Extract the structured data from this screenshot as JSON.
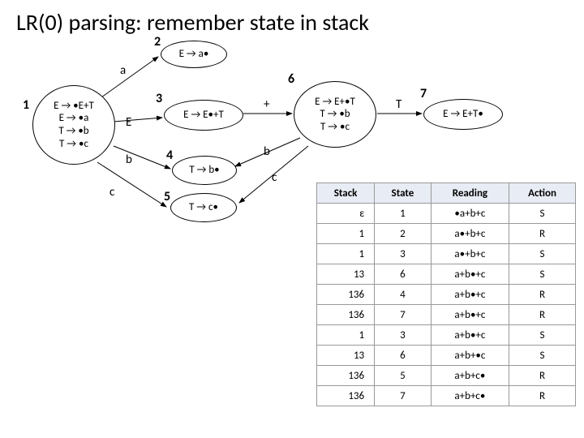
{
  "title": "LR(0) parsing: remember state in stack",
  "states": {
    "s1": {
      "num": "1",
      "lines": [
        "E → •E+T",
        "E → •a",
        "T → •b",
        "T → •c"
      ]
    },
    "s2": {
      "num": "2",
      "lines": [
        "E → a•"
      ]
    },
    "s3": {
      "num": "3",
      "lines": [
        "E → E•+T"
      ]
    },
    "s4": {
      "num": "4",
      "lines": [
        "T → b•"
      ]
    },
    "s5": {
      "num": "5",
      "lines": [
        "T → c•"
      ]
    },
    "s6": {
      "num": "6",
      "lines": [
        "E → E+•T",
        "T → •b",
        "T → •c"
      ]
    },
    "s7": {
      "num": "7",
      "lines": [
        "E → E+T•"
      ]
    }
  },
  "edges": {
    "a": "a",
    "E": "E",
    "b": "b",
    "c": "c",
    "plus": "+",
    "b2": "b",
    "c2": "c",
    "T": "T"
  },
  "table": {
    "headers": [
      "Stack",
      "State",
      "Reading",
      "Action"
    ],
    "rows": [
      [
        "ε",
        "1",
        "•a+b+c",
        "S"
      ],
      [
        "1",
        "2",
        "a•+b+c",
        "R"
      ],
      [
        "1",
        "3",
        "a•+b+c",
        "S"
      ],
      [
        "13",
        "6",
        "a+b•+c",
        "S"
      ],
      [
        "136",
        "4",
        "a+b•+c",
        "R"
      ],
      [
        "136",
        "7",
        "a+b•+c",
        "R"
      ],
      [
        "1",
        "3",
        "a+b•+c",
        "S"
      ],
      [
        "13",
        "6",
        "a+b+•c",
        "S"
      ],
      [
        "136",
        "5",
        "a+b+c•",
        "R"
      ],
      [
        "136",
        "7",
        "a+b+c•",
        "R"
      ]
    ]
  }
}
